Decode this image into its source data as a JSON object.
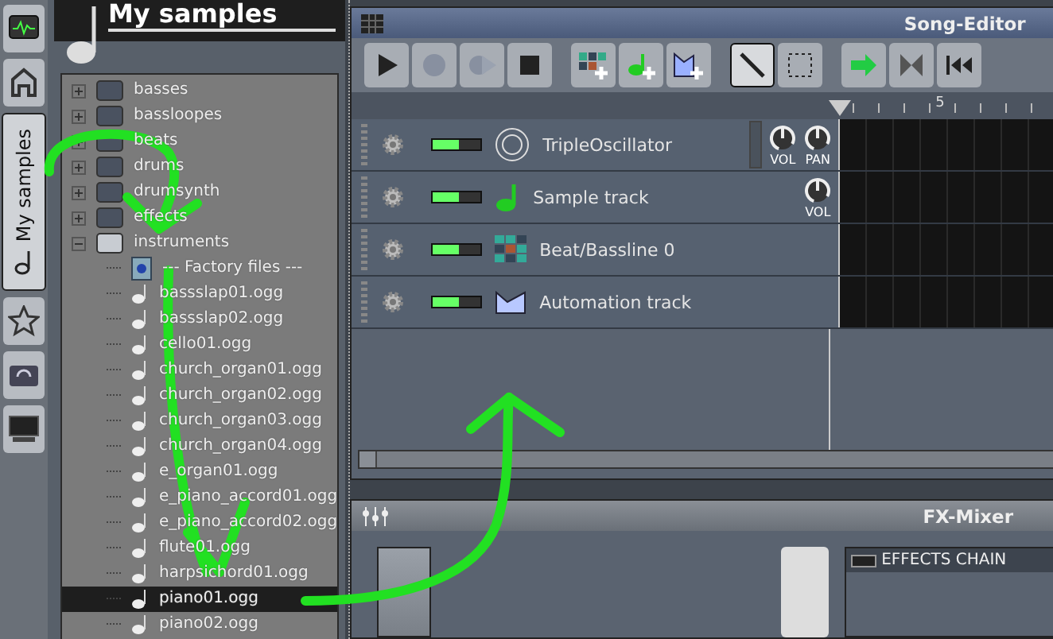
{
  "sidebar": {
    "tabs": [
      {
        "selected": false
      },
      {
        "selected": false
      },
      {
        "label": "My samples",
        "selected": true
      },
      {
        "selected": false
      },
      {
        "selected": false
      },
      {
        "selected": false
      }
    ]
  },
  "browser": {
    "title": "My samples",
    "tree": [
      {
        "kind": "folder",
        "label": "basses",
        "expanded": false
      },
      {
        "kind": "folder",
        "label": "bassloopes",
        "expanded": false
      },
      {
        "kind": "folder",
        "label": "beats",
        "expanded": false
      },
      {
        "kind": "folder",
        "label": "drums",
        "expanded": false
      },
      {
        "kind": "folder",
        "label": "drumsynth",
        "expanded": false
      },
      {
        "kind": "folder",
        "label": "effects",
        "expanded": false
      },
      {
        "kind": "folder",
        "label": "instruments",
        "expanded": true,
        "children": [
          {
            "kind": "info",
            "label": "--- Factory files ---",
            "selected": false
          },
          {
            "kind": "file",
            "label": "bassslap01.ogg",
            "selected": false
          },
          {
            "kind": "file",
            "label": "bassslap02.ogg",
            "selected": false
          },
          {
            "kind": "file",
            "label": "cello01.ogg",
            "selected": false
          },
          {
            "kind": "file",
            "label": "church_organ01.ogg",
            "selected": false
          },
          {
            "kind": "file",
            "label": "church_organ02.ogg",
            "selected": false
          },
          {
            "kind": "file",
            "label": "church_organ03.ogg",
            "selected": false
          },
          {
            "kind": "file",
            "label": "church_organ04.ogg",
            "selected": false
          },
          {
            "kind": "file",
            "label": "e_organ01.ogg",
            "selected": false
          },
          {
            "kind": "file",
            "label": "e_piano_accord01.ogg",
            "selected": false
          },
          {
            "kind": "file",
            "label": "e_piano_accord02.ogg",
            "selected": false
          },
          {
            "kind": "file",
            "label": "flute01.ogg",
            "selected": false
          },
          {
            "kind": "file",
            "label": "harpsichord01.ogg",
            "selected": false
          },
          {
            "kind": "file",
            "label": "piano01.ogg",
            "selected": true
          },
          {
            "kind": "file",
            "label": "piano02.ogg",
            "selected": false
          }
        ]
      }
    ]
  },
  "song_editor": {
    "title": "Song-Editor",
    "toolbar": [
      {
        "kind": "play",
        "selected": false
      },
      {
        "kind": "record",
        "selected": false
      },
      {
        "kind": "record-play",
        "selected": false
      },
      {
        "kind": "stop",
        "selected": false
      },
      {
        "kind": "add-bb",
        "selected": false
      },
      {
        "kind": "add-sample",
        "selected": false
      },
      {
        "kind": "add-automation",
        "selected": false
      },
      {
        "kind": "draw",
        "selected": true
      },
      {
        "kind": "select",
        "selected": false
      },
      {
        "kind": "follow",
        "selected": false
      },
      {
        "kind": "loop",
        "selected": false
      },
      {
        "kind": "back",
        "selected": false
      }
    ],
    "timeline": {
      "bar_label": "5"
    },
    "tracks": [
      {
        "kind": "instrument",
        "name": "TripleOscillator",
        "on": true,
        "knobs": [
          "VOL",
          "PAN"
        ]
      },
      {
        "kind": "sample",
        "name": "Sample track",
        "on": true,
        "knobs": [
          "VOL"
        ]
      },
      {
        "kind": "bb",
        "name": "Beat/Bassline 0",
        "on": true
      },
      {
        "kind": "automation",
        "name": "Automation track",
        "on": true
      }
    ]
  },
  "fx_mixer": {
    "title": "FX-Mixer",
    "effects_chain": {
      "label": "EFFECTS CHAIN",
      "on": false
    }
  }
}
